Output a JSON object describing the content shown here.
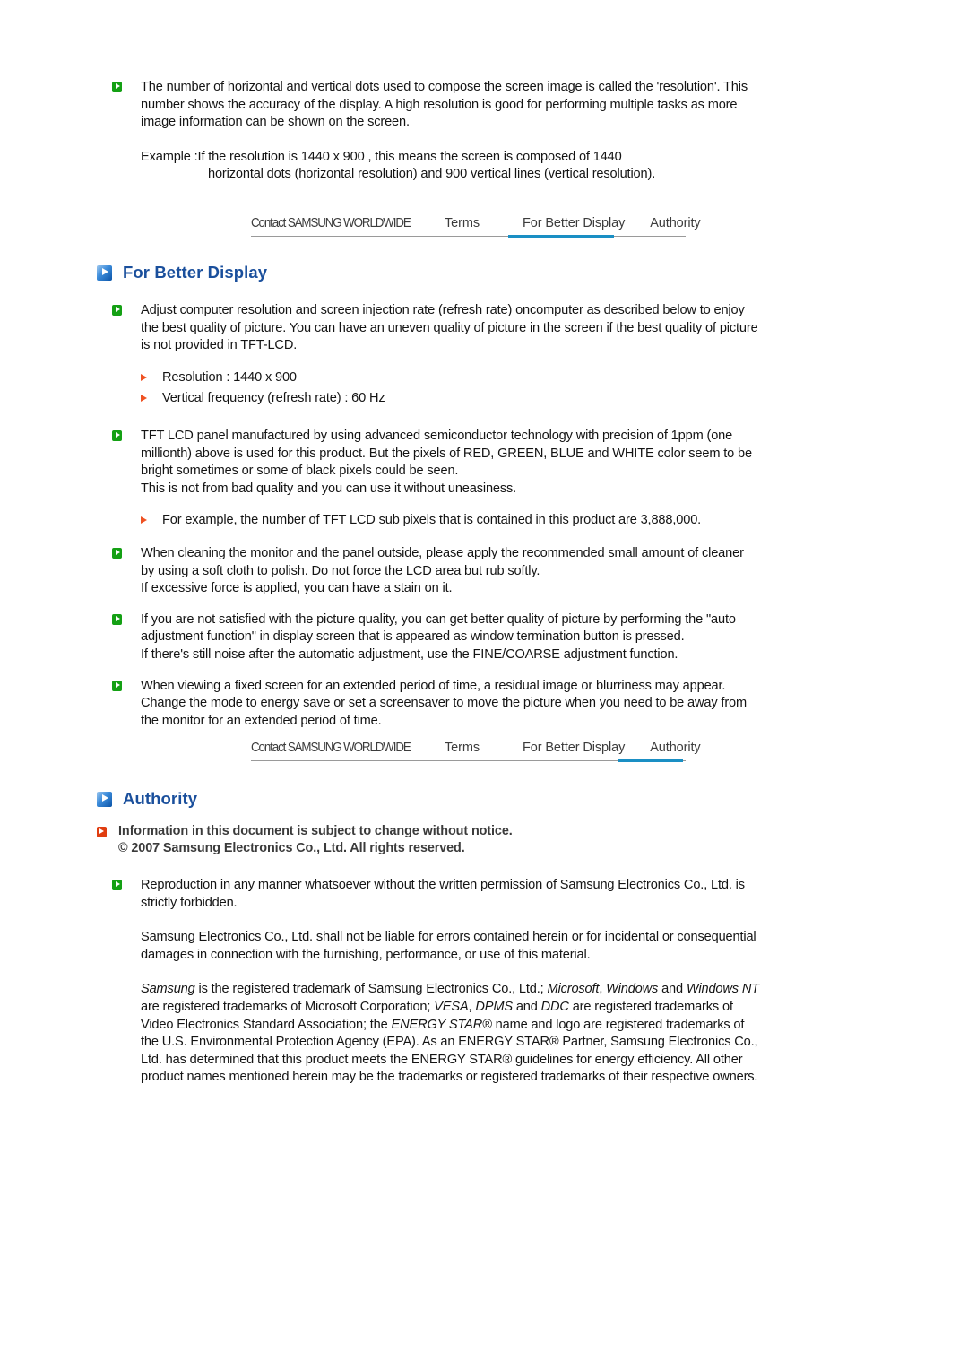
{
  "document": {
    "title": "For Better Display / Authority",
    "colors": {
      "heading": "#1a4f9c",
      "active_tab_underline": "#1a8fc4",
      "green_bullet": "#14a014",
      "orange_bullet": "#e03d10",
      "orange_triangle": "#ef5223",
      "body_text": "#141414",
      "tab_text": "#3c3c3c",
      "notice_text": "#3b3b3b"
    }
  },
  "intro": {
    "bullet_icon": "green-square-triangle-icon",
    "paragraph": "The number of horizontal and vertical dots used to compose the screen image is called the 'resolution'. This number shows the accuracy of the display. A high resolution is good for performing multiple tasks as more image information can be shown on the screen.",
    "example_line_1": "Example :If the resolution is 1440 x 900 , this means the screen is composed of 1440",
    "example_line_2": "horizontal dots (horizontal resolution) and 900 vertical lines (vertical resolution)."
  },
  "tabbar_top": {
    "tabs": [
      {
        "label": "Contact SAMSUNG WORLDWIDE",
        "active": false
      },
      {
        "label": "Terms",
        "active": false
      },
      {
        "label": "For Better Display",
        "active": true
      },
      {
        "label": "Authority",
        "active": false
      }
    ]
  },
  "tabbar_bottom": {
    "tabs": [
      {
        "label": "Contact SAMSUNG WORLDWIDE",
        "active": false
      },
      {
        "label": "Terms",
        "active": false
      },
      {
        "label": "For Better Display",
        "active": false
      },
      {
        "label": "Authority",
        "active": true
      }
    ]
  },
  "better_display": {
    "heading": "For Better Display",
    "heading_icon": "blue-square-triangle-icon",
    "bullets": [
      {
        "icon": "green-square-triangle-icon",
        "lines": [
          "Adjust computer resolution and screen injection rate (refresh rate) oncomputer as described below to enjoy the best quality of picture. You can have an uneven quality of picture in the screen if the best quality of picture is not provided in TFT-LCD."
        ],
        "sub_bullets": [
          "Resolution : 1440 x 900",
          "Vertical frequency (refresh rate) : 60 Hz"
        ]
      },
      {
        "icon": "green-square-triangle-icon",
        "lines": [
          "TFT LCD panel manufactured by using advanced semiconductor technology with precision of 1ppm (one millionth) above is used for this product. But the pixels of RED, GREEN, BLUE and WHITE color seem to be bright sometimes or some of black pixels could be seen.",
          "This is not from bad quality and you can use it without uneasiness."
        ],
        "sub_bullets": [
          "For example, the number of TFT LCD sub pixels that is contained in this product are 3,888,000."
        ]
      },
      {
        "icon": "green-square-triangle-icon",
        "lines": [
          "When cleaning the monitor and the panel outside, please apply the recommended small amount of cleaner by using a soft cloth to polish. Do not force the LCD area but rub softly.",
          "If excessive force is applied, you can have a stain on it."
        ],
        "sub_bullets": []
      },
      {
        "icon": "green-square-triangle-icon",
        "lines": [
          "If you are not satisfied with the picture quality, you can get better quality of picture by performing the \"auto adjustment function\" in display screen that is appeared as window termination button is pressed.",
          "If there's still noise after the automatic adjustment, use the FINE/COARSE adjustment function."
        ],
        "sub_bullets": []
      },
      {
        "icon": "green-square-triangle-icon",
        "lines": [
          "When viewing a fixed screen for an extended period of time, a residual image or blurriness may appear.",
          "Change the mode to energy save or set a screensaver to move the picture when you need to be away from the monitor for an extended period of time."
        ],
        "sub_bullets": []
      }
    ]
  },
  "authority": {
    "heading": "Authority",
    "heading_icon": "blue-square-triangle-icon",
    "notice_icon": "orange-square-triangle-icon",
    "notice_line_1": "Information in this document is subject to change without notice.",
    "notice_line_2": "© 2007 Samsung Electronics Co., Ltd. All rights reserved.",
    "bullet_icon": "green-square-triangle-icon",
    "reproduction": "Reproduction in any manner whatsoever without the written permission of Samsung Electronics Co., Ltd. is strictly forbidden.",
    "liability": "Samsung Electronics Co., Ltd. shall not be liable for errors contained herein or for incidental or consequential damages in connection with the furnishing, performance, or use of this material.",
    "trademark": {
      "t1": "Samsung",
      "s1": " is the registered trademark of Samsung Electronics Co., Ltd.; ",
      "t2": "Microsoft",
      "s2": ", ",
      "t3": "Windows",
      "s3": " and ",
      "t4": "Windows NT",
      "s4": " are registered trademarks of Microsoft Corporation; ",
      "t5": "VESA",
      "s5": ", ",
      "t6": "DPMS",
      "s6": " and ",
      "t7": "DDC",
      "s7": " are registered trademarks of Video Electronics Standard Association; the ",
      "t8": "ENERGY STAR®",
      "s8": " name and logo are registered trademarks of the U.S. Environmental Protection Agency (EPA). As an ENERGY STAR® Partner, Samsung Electronics Co., Ltd. has determined that this product meets the ENERGY STAR® guidelines for energy efficiency. All other product names mentioned herein may be the trademarks or registered trademarks of their respective owners."
    }
  }
}
